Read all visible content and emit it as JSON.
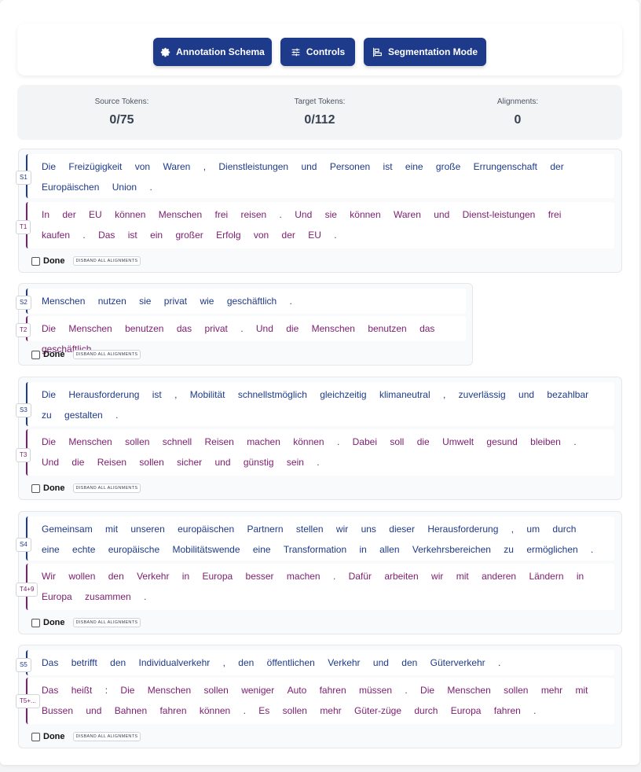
{
  "toolbar": {
    "annotation_schema": "Annotation Schema",
    "controls": "Controls",
    "segmentation_mode": "Segmentation Mode"
  },
  "stats": {
    "source_label": "Source Tokens:",
    "source_value": "0/75",
    "target_label": "Target Tokens:",
    "target_value": "0/112",
    "alignments_label": "Alignments:",
    "alignments_value": "0"
  },
  "pairs": [
    {
      "src_tag": "S1",
      "src_tokens": [
        "Die",
        "Freizügigkeit",
        "von",
        "Waren",
        ",",
        "Dienstleistungen",
        "und",
        "Personen",
        "ist",
        "eine",
        "große",
        "Errungenschaft",
        "der",
        "Europäischen",
        "Union",
        "."
      ],
      "tgt_tag": "T1",
      "tgt_tokens": [
        "In",
        "der",
        "EU",
        "können",
        "Menschen",
        "frei",
        "reisen",
        ".",
        "Und",
        "sie",
        "können",
        "Waren",
        "und",
        "Dienst-leistungen",
        "frei",
        "kaufen",
        ".",
        "Das",
        "ist",
        "ein",
        "großer",
        "Erfolg",
        "von",
        "der",
        "EU",
        "."
      ],
      "done": "Done",
      "disband": "DISBAND ALL ALIGNMENTS"
    },
    {
      "src_tag": "S2",
      "src_tokens": [
        "Menschen",
        "nutzen",
        "sie",
        "privat",
        "wie",
        "geschäftlich",
        "."
      ],
      "tgt_tag": "T2",
      "tgt_tokens": [
        "Die",
        "Menschen",
        "benutzen",
        "das",
        "privat",
        ".",
        "Und",
        "die",
        "Menschen",
        "benutzen",
        "das",
        "geschäftlich",
        "."
      ],
      "done": "Done",
      "disband": "DISBAND ALL ALIGNMENTS"
    },
    {
      "src_tag": "S3",
      "src_tokens": [
        "Die",
        "Herausforderung",
        "ist",
        ",",
        "Mobilität",
        "schnellstmöglich",
        "gleichzeitig",
        "klimaneutral",
        ",",
        "zuverlässig",
        "und",
        "bezahlbar",
        "zu",
        "gestalten",
        "."
      ],
      "tgt_tag": "T3",
      "tgt_tokens": [
        "Die",
        "Menschen",
        "sollen",
        "schnell",
        "Reisen",
        "machen",
        "können",
        ".",
        "Dabei",
        "soll",
        "die",
        "Umwelt",
        "gesund",
        "bleiben",
        ".",
        "Und",
        "die",
        "Reisen",
        "sollen",
        "sicher",
        "und",
        "günstig",
        "sein",
        "."
      ],
      "done": "Done",
      "disband": "DISBAND ALL ALIGNMENTS"
    },
    {
      "src_tag": "S4",
      "src_tokens": [
        "Gemeinsam",
        "mit",
        "unseren",
        "europäischen",
        "Partnern",
        "stellen",
        "wir",
        "uns",
        "dieser",
        "Herausforderung",
        ",",
        "um",
        "durch",
        "eine",
        "echte",
        "europäische",
        "Mobilitätswende",
        "eine",
        "Transformation",
        "in",
        "allen",
        "Verkehrsbereichen",
        "zu",
        "ermöglichen",
        "."
      ],
      "tgt_tag": "T4+9",
      "tgt_tokens": [
        "Wir",
        "wollen",
        "den",
        "Verkehr",
        "in",
        "Europa",
        "besser",
        "machen",
        ".",
        "Dafür",
        "arbeiten",
        "wir",
        "mit",
        "anderen",
        "Ländern",
        "in",
        "Europa",
        "zusammen",
        "."
      ],
      "done": "Done",
      "disband": "DISBAND ALL ALIGNMENTS"
    },
    {
      "src_tag": "S5",
      "src_tokens": [
        "Das",
        "betrifft",
        "den",
        "Individualverkehr",
        ",",
        "den",
        "öffentlichen",
        "Verkehr",
        "und",
        "den",
        "Güterverkehr",
        "."
      ],
      "tgt_tag": "T5+...",
      "tgt_tokens": [
        "Das",
        "heißt",
        ":",
        "Die",
        "Menschen",
        "sollen",
        "weniger",
        "Auto",
        "fahren",
        "müssen",
        ".",
        "Die",
        "Menschen",
        "sollen",
        "mehr",
        "mit",
        "Bussen",
        "und",
        "Bahnen",
        "fahren",
        "können",
        ".",
        "Es",
        "sollen",
        "mehr",
        "Güter-züge",
        "durch",
        "Europa",
        "fahren",
        "."
      ],
      "done": "Done",
      "disband": "DISBAND ALL ALIGNMENTS"
    }
  ]
}
